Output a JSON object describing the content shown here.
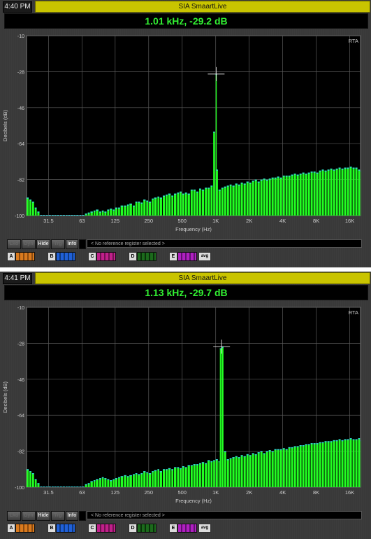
{
  "windows": [
    {
      "clock": "4:40 PM",
      "app_title": "SIA SmaartLive",
      "readout": "1.01 kHz, -29.2 dB",
      "plot_mode": "RTA",
      "y_ticks": [
        "-10",
        "-28",
        "-46",
        "-64",
        "-82",
        "-100"
      ],
      "x_ticks": [
        "31.5",
        "63",
        "125",
        "250",
        "500",
        "1K",
        "2K",
        "4K",
        "8K",
        "16K"
      ],
      "y_label": "Decibels (dB)",
      "x_label": "Frequency (Hz)",
      "buttons": {
        "b1": "Lkd",
        "b2": "Dyn",
        "hide": "Hide",
        "b4": "Trg",
        "info": "Info"
      },
      "ref_message": "< No reference register selected >",
      "registers": [
        "A",
        "B",
        "C",
        "D",
        "E"
      ],
      "avg_label": "avg"
    },
    {
      "clock": "4:41 PM",
      "app_title": "SIA SmaartLive",
      "readout": "1.13 kHz, -29.7 dB",
      "plot_mode": "RTA",
      "y_ticks": [
        "-10",
        "-28",
        "-46",
        "-64",
        "-82",
        "-100"
      ],
      "x_ticks": [
        "31.5",
        "63",
        "125",
        "250",
        "500",
        "1K",
        "2K",
        "4K",
        "8K",
        "16K"
      ],
      "y_label": "Decibels (dB)",
      "x_label": "Frequency (Hz)",
      "buttons": {
        "b1": "Lkd",
        "b2": "Dyn",
        "hide": "Hide",
        "b4": "Trg",
        "info": "Info"
      },
      "ref_message": "< No reference register selected >",
      "registers": [
        "A",
        "B",
        "C",
        "D",
        "E"
      ],
      "avg_label": "avg"
    }
  ],
  "colors": {
    "bar_fill": "#22ff22",
    "bar_top": "#33d6e0",
    "readout_text": "#32f032",
    "title_bg": "#c9c400",
    "register_colors": [
      "#d97a1e",
      "#2060d8",
      "#c0208a",
      "#1c6a1c",
      "#b020c0"
    ]
  },
  "chart_data": [
    {
      "type": "bar",
      "title": "",
      "xlabel": "Frequency (Hz)",
      "ylabel": "Decibels (dB)",
      "ylim": [
        -100,
        -10
      ],
      "x_scale": "log",
      "xlim": [
        20,
        20000
      ],
      "grid": true,
      "peak": {
        "freq": 1010,
        "db": -29.2
      },
      "x": [
        20,
        21.2,
        22.4,
        23.7,
        25,
        26.5,
        28,
        29.9,
        31.5,
        33.6,
        35.5,
        37.5,
        40,
        42.2,
        45,
        47.3,
        50,
        53,
        56,
        59.6,
        63,
        67,
        71,
        75,
        80,
        84,
        90,
        95,
        100,
        106,
        112,
        119,
        125,
        133,
        140,
        150,
        160,
        168,
        180,
        190,
        200,
        212,
        224,
        238,
        250,
        267,
        280,
        300,
        315,
        335,
        355,
        375,
        400,
        422,
        450,
        475,
        500,
        530,
        560,
        596,
        630,
        670,
        710,
        750,
        800,
        845,
        900,
        950,
        1000,
        1010,
        1060,
        1125,
        1190,
        1260,
        1335,
        1410,
        1500,
        1590,
        1680,
        1780,
        1890,
        2000,
        2120,
        2245,
        2380,
        2520,
        2670,
        2830,
        3000,
        3175,
        3365,
        3565,
        3775,
        4000,
        4240,
        4490,
        4760,
        5040,
        5340,
        5660,
        6000,
        6350,
        6730,
        7130,
        7550,
        8000,
        8480,
        8980,
        9510,
        10080,
        10680,
        11310,
        12000,
        12700,
        13450,
        14250,
        15100,
        16000,
        16950,
        17960,
        19030,
        20000
      ],
      "values": [
        -91,
        -92,
        -93,
        -96,
        -98,
        -100,
        -100,
        -100,
        -100,
        -100,
        -100,
        -100,
        -100,
        -100,
        -100,
        -100,
        -100,
        -100,
        -100,
        -100,
        -100,
        -99,
        -98.5,
        -98,
        -97.5,
        -97,
        -98,
        -97.5,
        -98,
        -97,
        -96.5,
        -97,
        -96,
        -96,
        -95,
        -95,
        -94.5,
        -94,
        -95,
        -93,
        -93,
        -93.5,
        -92,
        -92.5,
        -93,
        -91.5,
        -91,
        -90.5,
        -91,
        -90,
        -89.5,
        -89,
        -90,
        -89,
        -88.5,
        -88,
        -89,
        -88.5,
        -89,
        -87,
        -87,
        -88,
        -86.5,
        -87,
        -86,
        -86,
        -85,
        -58,
        -29.2,
        -77,
        -87,
        -86,
        -85.5,
        -85,
        -84.5,
        -85,
        -84,
        -84.5,
        -83.5,
        -84,
        -83,
        -83.5,
        -82.5,
        -82,
        -83,
        -82,
        -81.5,
        -82,
        -81.5,
        -81,
        -81,
        -80.5,
        -81,
        -80,
        -80,
        -80,
        -79.5,
        -79,
        -79.5,
        -79,
        -78.5,
        -79,
        -78.5,
        -78,
        -78,
        -78.5,
        -77.5,
        -77,
        -77.5,
        -77,
        -76.5,
        -77,
        -76.5,
        -76,
        -76.5,
        -76,
        -76,
        -75.5,
        -76,
        -76,
        -77,
        -77.5
      ]
    },
    {
      "type": "bar",
      "title": "",
      "xlabel": "Frequency (Hz)",
      "ylabel": "Decibels (dB)",
      "ylim": [
        -100,
        -10
      ],
      "x_scale": "log",
      "xlim": [
        20,
        20000
      ],
      "grid": true,
      "peak": {
        "freq": 1130,
        "db": -29.7
      },
      "x": [
        20,
        21.2,
        22.4,
        23.7,
        25,
        26.5,
        28,
        29.9,
        31.5,
        33.6,
        35.5,
        37.5,
        40,
        42.2,
        45,
        47.3,
        50,
        53,
        56,
        59.6,
        63,
        67,
        71,
        75,
        80,
        84,
        90,
        95,
        100,
        106,
        112,
        119,
        125,
        133,
        140,
        150,
        160,
        168,
        180,
        190,
        200,
        212,
        224,
        238,
        250,
        267,
        280,
        300,
        315,
        335,
        355,
        375,
        400,
        422,
        450,
        475,
        500,
        530,
        560,
        596,
        630,
        670,
        710,
        750,
        800,
        845,
        900,
        950,
        1000,
        1060,
        1090,
        1130,
        1190,
        1260,
        1335,
        1410,
        1500,
        1590,
        1680,
        1780,
        1890,
        2000,
        2120,
        2245,
        2380,
        2520,
        2670,
        2830,
        3000,
        3175,
        3365,
        3565,
        3775,
        4000,
        4240,
        4490,
        4760,
        5040,
        5340,
        5660,
        6000,
        6350,
        6730,
        7130,
        7550,
        8000,
        8480,
        8980,
        9510,
        10080,
        10680,
        11310,
        12000,
        12700,
        13450,
        14250,
        15100,
        16000,
        16950,
        17960,
        19030,
        20000
      ],
      "values": [
        -91,
        -92,
        -93,
        -96,
        -98,
        -100,
        -100,
        -100,
        -100,
        -100,
        -100,
        -100,
        -100,
        -100,
        -100,
        -100,
        -100,
        -100,
        -100,
        -100,
        -100,
        -98.5,
        -98,
        -97,
        -96.5,
        -96,
        -95.5,
        -95,
        -95.5,
        -96,
        -96.5,
        -96,
        -95.5,
        -95,
        -94.5,
        -94,
        -94.5,
        -94,
        -93.5,
        -93,
        -93.5,
        -93,
        -92,
        -92.5,
        -93,
        -92,
        -91.5,
        -91,
        -92,
        -91,
        -91,
        -90.5,
        -91,
        -90,
        -90,
        -90.5,
        -89.5,
        -90,
        -89,
        -89,
        -88.5,
        -88.5,
        -88,
        -87.5,
        -88,
        -86.5,
        -87,
        -86.5,
        -86,
        -87,
        -30.5,
        -29.7,
        -82,
        -86,
        -85.5,
        -85,
        -84.5,
        -85,
        -84,
        -84.5,
        -83.5,
        -84,
        -83,
        -83.5,
        -82.5,
        -82,
        -83,
        -82,
        -81.5,
        -82,
        -81,
        -81,
        -81,
        -80.5,
        -81,
        -80,
        -80,
        -79.5,
        -79.5,
        -79,
        -79,
        -78.5,
        -78.5,
        -78,
        -78,
        -78,
        -77.5,
        -77.5,
        -77,
        -77,
        -77,
        -76.5,
        -76.5,
        -76,
        -76.5,
        -76,
        -76,
        -75.5,
        -76,
        -76,
        -75.5,
        -76.5
      ]
    }
  ]
}
